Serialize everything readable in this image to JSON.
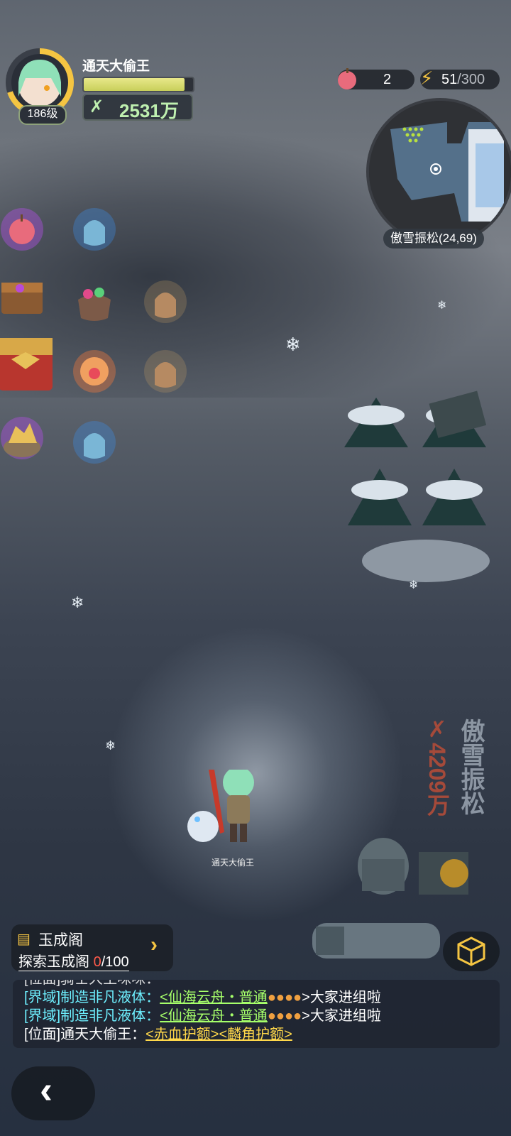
{
  "header": {
    "player_name": "通天大偷王",
    "level": "186级",
    "combat_power": "2531万",
    "hp_fraction": 0.92
  },
  "resources": {
    "apple_count": "2",
    "energy_current": "51",
    "energy_max": "/300"
  },
  "minimap": {
    "location_label": "傲雪振松(24,69)"
  },
  "scene": {
    "character_name": "通天大偷王",
    "area_name_vertical": "傲雪振松",
    "area_power": "4209万"
  },
  "quest": {
    "title": "玉成阁",
    "desc_prefix": "探索玉成阁 ",
    "progress_current": "0",
    "progress_total": "/100"
  },
  "chat": {
    "line0": "[位面]骑士大王咪咪：",
    "line1_prefix": "[界域]制造非凡液体：",
    "line1_link": "<仙海云舟・普通",
    "line1_suffix": ">大家进组啦",
    "line2_prefix": "[界域]制造非凡液体：",
    "line2_link": "<仙海云舟・普通",
    "line2_suffix": ">大家进组啦",
    "line3_prefix": "[位面]通天大偷王：",
    "line3_link": "<赤血护额><麟角护额>"
  },
  "colors": {
    "accent_gold": "#f5c542",
    "power_green": "#bff0b0",
    "chat_cyan": "#6ef0ff",
    "chat_link_green": "#a6ff6a",
    "chat_link_yellow": "#ffd84a",
    "progress_red": "#ff5a4a"
  }
}
